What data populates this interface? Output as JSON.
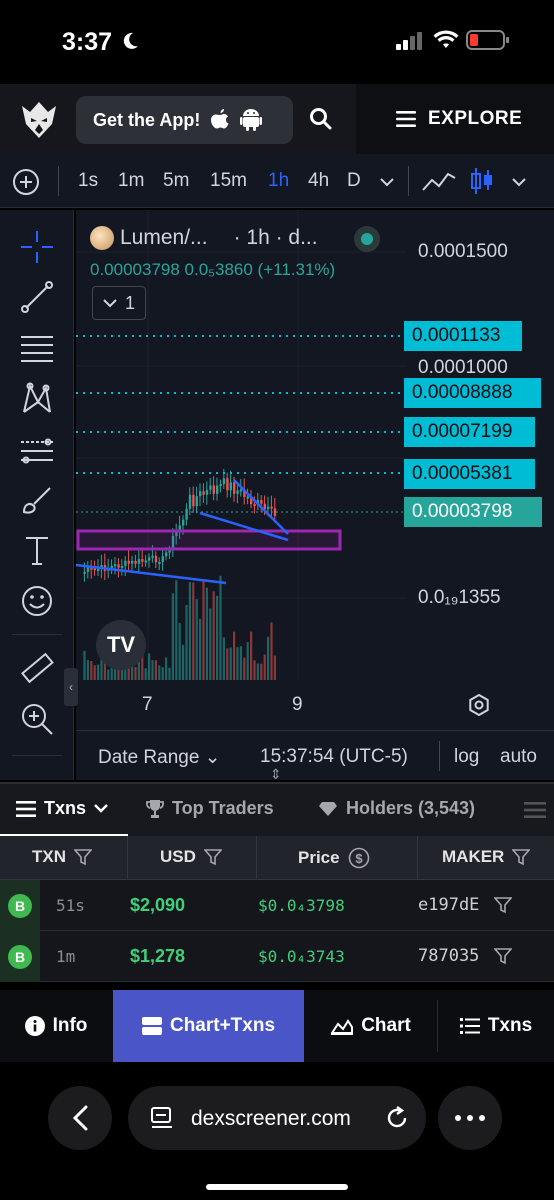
{
  "status_bar": {
    "time": "3:37"
  },
  "header": {
    "get_app_label": "Get the App!",
    "explore_label": "EXPLORE"
  },
  "timeframes": [
    "1s",
    "1m",
    "5m",
    "15m",
    "1h",
    "4h",
    "D"
  ],
  "timeframe_active": "1h",
  "chart": {
    "symbol": "Lumen/...",
    "interval_label": "· 1h · d...",
    "ohlc_text": "0.00003798  0.0₅3860 (+11.31%)",
    "collapse_count": "1",
    "accent_colors": {
      "up": "#26a69a",
      "down": "#ef5350",
      "alert_line": "#00bcd4",
      "zone": "#9c27b0",
      "trendline": "#2962ff"
    },
    "axis_labels": [
      {
        "text": "0.0001500"
      },
      {
        "text": "0.0001000"
      },
      {
        "text": "0.0₁₉1355"
      }
    ],
    "price_tags": [
      {
        "text": "0.0001133",
        "color": "#00bcd4"
      },
      {
        "text": "0.00008888",
        "color": "#00bcd4"
      },
      {
        "text": "0.00007199",
        "color": "#00bcd4"
      },
      {
        "text": "0.00005381",
        "color": "#00bcd4"
      },
      {
        "text": "0.00003798",
        "color": "#26a69a"
      }
    ],
    "x_labels": [
      "7",
      "9"
    ],
    "date_range_label": "Date Range",
    "clock": "15:37:54 (UTC-5)",
    "log_label": "log",
    "auto_label": "auto"
  },
  "txn_tabs": [
    {
      "label": "Txns",
      "icon": "list-icon"
    },
    {
      "label": "Top Traders",
      "icon": "trophy-icon"
    },
    {
      "label": "Holders (3,543)",
      "icon": "diamond-icon"
    }
  ],
  "table": {
    "headers": [
      "TXN",
      "USD",
      "Price",
      "MAKER"
    ],
    "rows": [
      {
        "type": "B",
        "age": "51s",
        "usd": "$2,090",
        "price": "$0.0₄3798",
        "maker": "e197dE"
      },
      {
        "type": "B",
        "age": "1m",
        "usd": "$1,278",
        "price": "$0.0₄3743",
        "maker": "787035"
      }
    ]
  },
  "bottom_nav": [
    {
      "label": "Info",
      "icon": "info-icon"
    },
    {
      "label": "Chart+Txns",
      "icon": "split-icon"
    },
    {
      "label": "Chart",
      "icon": "chart-icon"
    },
    {
      "label": "Txns",
      "icon": "list-icon"
    }
  ],
  "browser": {
    "url": "dexscreener.com"
  }
}
